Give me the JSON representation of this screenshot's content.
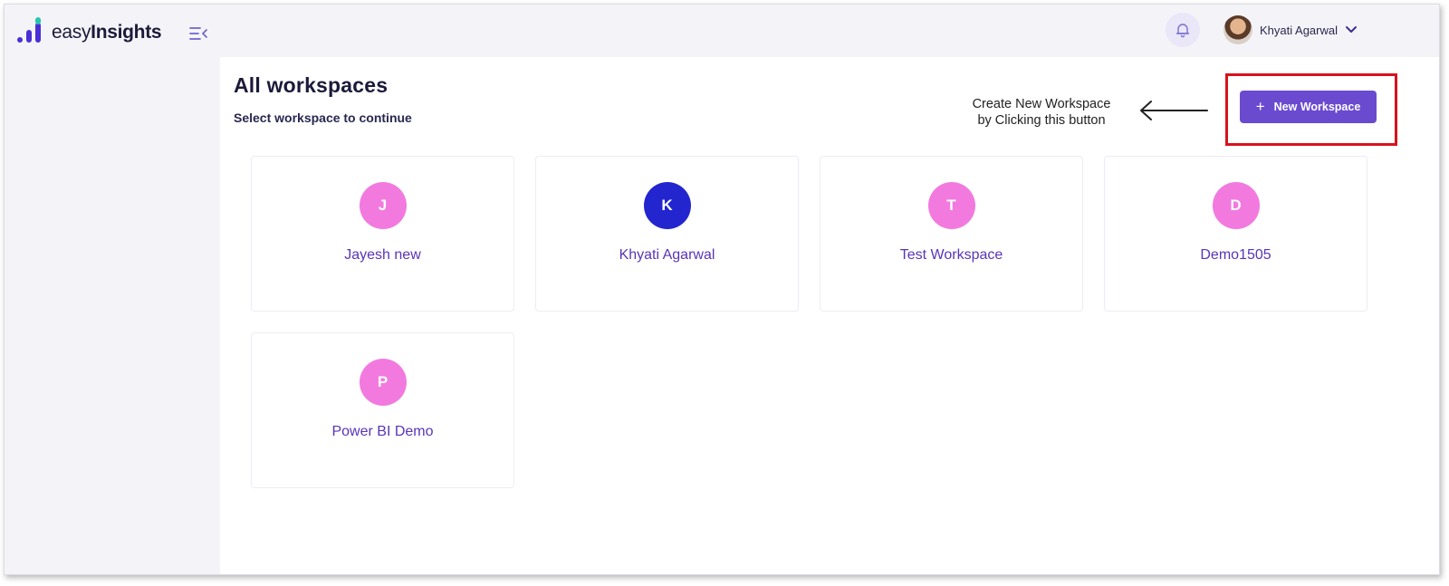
{
  "app": {
    "brand_light": "easy",
    "brand_bold": "Insights",
    "brand_color": "#4b2fd6",
    "brand_accent": "#26c6b0"
  },
  "header": {
    "notification_icon": "bell-icon",
    "user_name": "Khyati Agarwal",
    "user_menu_icon": "chevron-down-icon"
  },
  "sidebar": {
    "collapse_icon": "menu-collapse-icon"
  },
  "main": {
    "title": "All workspaces",
    "subtitle": "Select workspace to continue",
    "annotation_line1": "Create New Workspace",
    "annotation_line2": "by Clicking this button",
    "new_workspace_label": "New Workspace",
    "new_workspace_icon": "plus-icon",
    "accent_color": "#6a4bcf",
    "highlight_color": "#d8121c"
  },
  "workspaces": [
    {
      "initial": "J",
      "name": "Jayesh new",
      "color": "#f27adf"
    },
    {
      "initial": "K",
      "name": "Khyati Agarwal",
      "color": "#2326cf"
    },
    {
      "initial": "T",
      "name": "Test Workspace",
      "color": "#f27adf"
    },
    {
      "initial": "D",
      "name": "Demo1505",
      "color": "#f27adf"
    },
    {
      "initial": "P",
      "name": "Power BI Demo",
      "color": "#f27adf"
    }
  ]
}
